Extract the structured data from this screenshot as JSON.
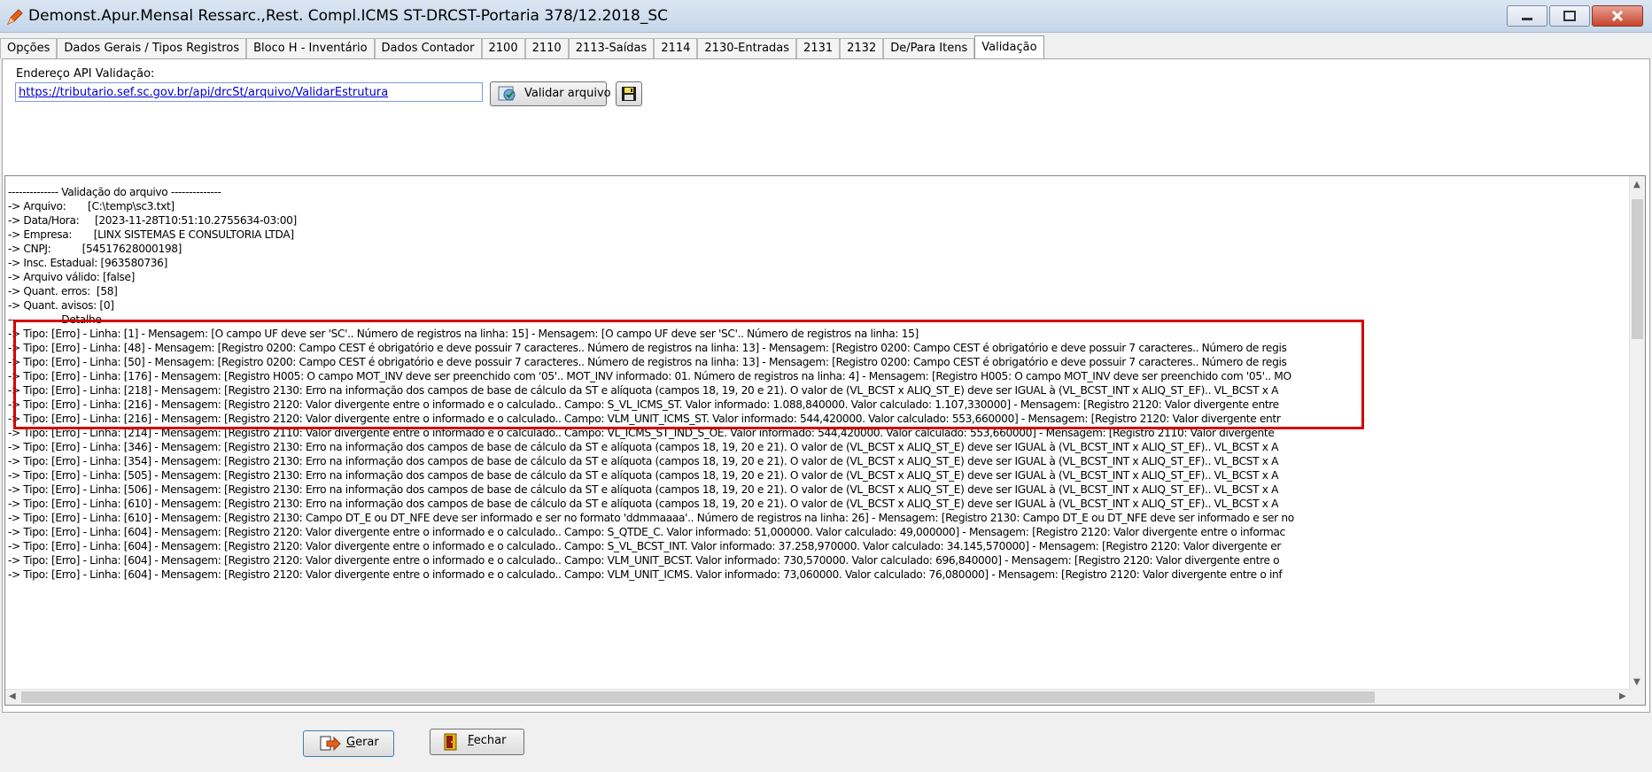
{
  "window": {
    "title": "Demonst.Apur.Mensal Ressarc.,Rest. Compl.ICMS ST-DRCST-Portaria 378/12.2018_SC"
  },
  "tabs": [
    "Opções",
    "Dados Gerais / Tipos Registros",
    "Bloco H - Inventário",
    "Dados Contador",
    "2100",
    "2110",
    "2113-Saídas",
    "2114",
    "2130-Entradas",
    "2131",
    "2132",
    "De/Para Itens",
    "Validação"
  ],
  "active_tab": "Validação",
  "api": {
    "label": "Endereço API Validação:",
    "url": "https://tributario.sef.sc.gov.br/api/drcSt/arquivo/ValidarEstrutura"
  },
  "buttons": {
    "validar": "Validar arquivo",
    "gerar_rest": "erar",
    "gerar_accel": "G",
    "fechar_rest": "echar",
    "fechar_accel": "F"
  },
  "log": [
    "-------------- Validação do arquivo --------------",
    "-> Arquivo:       [C:\\temp\\sc3.txt]",
    "-> Data/Hora:     [2023-11-28T10:51:10.2755634-03:00]",
    "-> Empresa:       [LINX SISTEMAS E CONSULTORIA LTDA]",
    "-> CNPJ:          [54517628000198]",
    "-> Insc. Estadual: [963580736]",
    "-> Arquivo válido: [false]",
    "-> Quant. erros:  [58]",
    "-> Quant. avisos: [0]",
    "-------------- Detalhe --------------",
    "-> Tipo: [Erro] - Linha: [1] - Mensagem: [O campo UF deve ser 'SC'.. Número de registros na linha: 15] - Mensagem: [O campo UF deve ser 'SC'.. Número de registros na linha: 15]",
    "-> Tipo: [Erro] - Linha: [48] - Mensagem: [Registro 0200: Campo CEST é obrigatório e deve possuir 7 caracteres.. Número de registros na linha: 13] - Mensagem: [Registro 0200: Campo CEST é obrigatório e deve possuir 7 caracteres.. Número de regis",
    "-> Tipo: [Erro] - Linha: [50] - Mensagem: [Registro 0200: Campo CEST é obrigatório e deve possuir 7 caracteres.. Número de registros na linha: 13] - Mensagem: [Registro 0200: Campo CEST é obrigatório e deve possuir 7 caracteres.. Número de regis",
    "-> Tipo: [Erro] - Linha: [176] - Mensagem: [Registro H005: O campo MOT_INV deve ser preenchido com '05'.. MOT_INV informado: 01. Número de registros na linha: 4] - Mensagem: [Registro H005: O campo MOT_INV deve ser preenchido com '05'.. MO",
    "-> Tipo: [Erro] - Linha: [218] - Mensagem: [Registro 2130: Erro na informação dos campos de base de cálculo da ST e alíquota (campos 18, 19, 20 e 21). O valor de (VL_BCST x ALIQ_ST_E) deve ser IGUAL à (VL_BCST_INT x ALIQ_ST_EF).. VL_BCST x A",
    "-> Tipo: [Erro] - Linha: [216] - Mensagem: [Registro 2120: Valor divergente entre o informado e o calculado.. Campo: S_VL_ICMS_ST. Valor informado: 1.088,840000. Valor calculado: 1.107,330000] - Mensagem: [Registro 2120: Valor divergente entre",
    "-> Tipo: [Erro] - Linha: [216] - Mensagem: [Registro 2120: Valor divergente entre o informado e o calculado.. Campo: VLM_UNIT_ICMS_ST. Valor informado: 544,420000. Valor calculado: 553,660000] - Mensagem: [Registro 2120: Valor divergente entr",
    "-> Tipo: [Erro] - Linha: [214] - Mensagem: [Registro 2110: Valor divergente entre o informado e o calculado.. Campo: VL_ICMS_ST_IND_S_OE. Valor informado: 544,420000. Valor calculado: 553,660000] - Mensagem: [Registro 2110: Valor divergente",
    "-> Tipo: [Erro] - Linha: [346] - Mensagem: [Registro 2130: Erro na informação dos campos de base de cálculo da ST e alíquota (campos 18, 19, 20 e 21). O valor de (VL_BCST x ALIQ_ST_E) deve ser IGUAL à (VL_BCST_INT x ALIQ_ST_EF).. VL_BCST x A",
    "-> Tipo: [Erro] - Linha: [354] - Mensagem: [Registro 2130: Erro na informação dos campos de base de cálculo da ST e alíquota (campos 18, 19, 20 e 21). O valor de (VL_BCST x ALIQ_ST_E) deve ser IGUAL à (VL_BCST_INT x ALIQ_ST_EF).. VL_BCST x A",
    "-> Tipo: [Erro] - Linha: [505] - Mensagem: [Registro 2130: Erro na informação dos campos de base de cálculo da ST e alíquota (campos 18, 19, 20 e 21). O valor de (VL_BCST x ALIQ_ST_E) deve ser IGUAL à (VL_BCST_INT x ALIQ_ST_EF).. VL_BCST x A",
    "-> Tipo: [Erro] - Linha: [506] - Mensagem: [Registro 2130: Erro na informação dos campos de base de cálculo da ST e alíquota (campos 18, 19, 20 e 21). O valor de (VL_BCST x ALIQ_ST_E) deve ser IGUAL à (VL_BCST_INT x ALIQ_ST_EF).. VL_BCST x A",
    "-> Tipo: [Erro] - Linha: [610] - Mensagem: [Registro 2130: Erro na informação dos campos de base de cálculo da ST e alíquota (campos 18, 19, 20 e 21). O valor de (VL_BCST x ALIQ_ST_E) deve ser IGUAL à (VL_BCST_INT x ALIQ_ST_EF).. VL_BCST x A",
    "-> Tipo: [Erro] - Linha: [610] - Mensagem: [Registro 2130: Campo DT_E ou DT_NFE deve ser informado e ser no formato 'ddmmaaaa'.. Número de registros na linha: 26] - Mensagem: [Registro 2130: Campo DT_E ou DT_NFE deve ser informado e ser no",
    "-> Tipo: [Erro] - Linha: [604] - Mensagem: [Registro 2120: Valor divergente entre o informado e o calculado.. Campo: S_QTDE_C. Valor informado: 51,000000. Valor calculado: 49,000000] - Mensagem: [Registro 2120: Valor divergente entre o informac",
    "-> Tipo: [Erro] - Linha: [604] - Mensagem: [Registro 2120: Valor divergente entre o informado e o calculado.. Campo: S_VL_BCST_INT. Valor informado: 37.258,970000. Valor calculado: 34.145,570000] - Mensagem: [Registro 2120: Valor divergente er",
    "-> Tipo: [Erro] - Linha: [604] - Mensagem: [Registro 2120: Valor divergente entre o informado e o calculado.. Campo: VLM_UNIT_BCST. Valor informado: 730,570000. Valor calculado: 696,840000] - Mensagem: [Registro 2120: Valor divergente entre o",
    "-> Tipo: [Erro] - Linha: [604] - Mensagem: [Registro 2120: Valor divergente entre o informado e o calculado.. Campo: VLM_UNIT_ICMS. Valor informado: 73,060000. Valor calculado: 76,080000] - Mensagem: [Registro 2120: Valor divergente entre o inf"
  ],
  "icons": {
    "app": "edit-pencil-icon",
    "validar": "globe-check-icon",
    "save": "floppy-disk-icon",
    "gerar": "export-arrow-icon",
    "fechar": "exit-door-icon"
  },
  "colors": {
    "highlight": "#d40000",
    "link": "#0000cc"
  }
}
